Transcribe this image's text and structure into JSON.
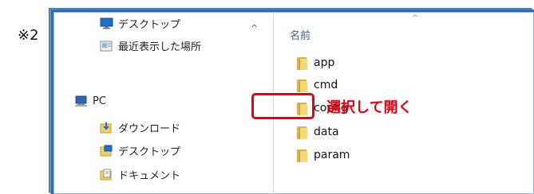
{
  "note_mark": "※2",
  "nav": {
    "items": [
      {
        "label": "デスクトップ",
        "icon": "desktop-icon"
      },
      {
        "label": "最近表示した場所",
        "icon": "recent-places-icon"
      },
      {
        "label": "PC",
        "icon": "pc-icon"
      },
      {
        "label": "ダウンロード",
        "icon": "downloads-icon"
      },
      {
        "label": "デスクトップ",
        "icon": "desktop-icon"
      },
      {
        "label": "ドキュメント",
        "icon": "documents-icon"
      }
    ],
    "expand_caret": "^"
  },
  "file_list": {
    "column_header": "名前",
    "sort_caret": "^",
    "items": [
      "app",
      "cmd",
      "config",
      "data",
      "param"
    ],
    "folder_color": "#f4d97a"
  },
  "annotation": {
    "callout": "選択して開く",
    "color": "#e60012"
  }
}
